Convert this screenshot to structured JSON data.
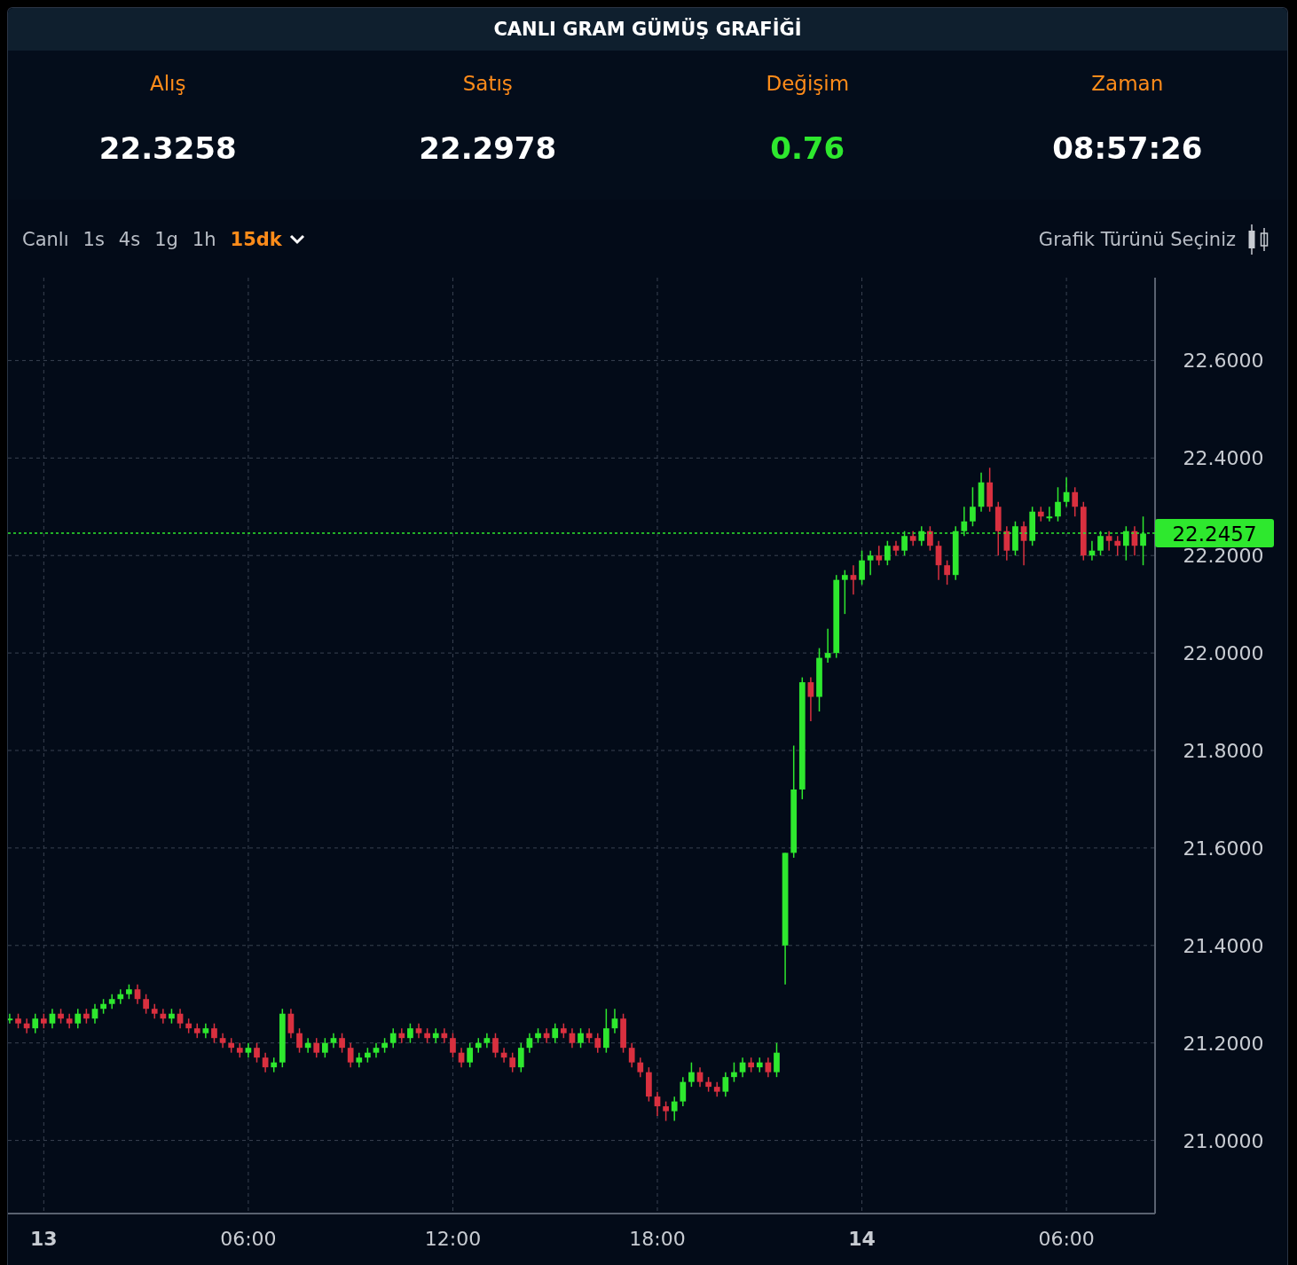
{
  "title": "CANLI GRAM GÜMÜŞ GRAFİĞİ",
  "stats": [
    {
      "label": "Alış",
      "value": "22.3258",
      "kind": "plain"
    },
    {
      "label": "Satış",
      "value": "22.2978",
      "kind": "plain"
    },
    {
      "label": "Değişim",
      "value": "0.76",
      "kind": "up"
    },
    {
      "label": "Zaman",
      "value": "08:57:26",
      "kind": "plain"
    }
  ],
  "timeframes": [
    {
      "label": "Canlı",
      "selected": false
    },
    {
      "label": "1s",
      "selected": false
    },
    {
      "label": "4s",
      "selected": false
    },
    {
      "label": "1g",
      "selected": false
    },
    {
      "label": "1h",
      "selected": false
    },
    {
      "label": "15dk",
      "selected": true
    }
  ],
  "chart_type_button": {
    "label": "Grafik Türünü Seçiniz"
  },
  "chart": {
    "chart_data": {
      "type": "candlestick",
      "grid": true,
      "ylim": [
        20.85,
        22.77
      ],
      "yticks": [
        {
          "value": 21.0,
          "label": "21.0000"
        },
        {
          "value": 21.2,
          "label": "21.2000"
        },
        {
          "value": 21.4,
          "label": "21.4000"
        },
        {
          "value": 21.6,
          "label": "21.6000"
        },
        {
          "value": 21.8,
          "label": "21.8000"
        },
        {
          "value": 22.0,
          "label": "22.0000"
        },
        {
          "value": 22.2,
          "label": "22.2000"
        },
        {
          "value": 22.4,
          "label": "22.4000"
        },
        {
          "value": 22.6,
          "label": "22.6000"
        }
      ],
      "xlim": [
        -1.05,
        32.6
      ],
      "xticks": [
        {
          "value": 6,
          "label": "06:00"
        },
        {
          "value": 12,
          "label": "12:00"
        },
        {
          "value": 18,
          "label": "18:00"
        }
      ],
      "x": [
        -1,
        -0.75,
        -0.5,
        -0.25,
        0,
        0.25,
        0.5,
        0.75,
        1,
        1.25,
        1.5,
        1.75,
        2,
        2.25,
        2.5,
        2.75,
        3,
        3.25,
        3.5,
        3.75,
        4,
        4.25,
        4.5,
        4.75,
        5,
        5.25,
        5.5,
        5.75,
        6,
        6.25,
        6.5,
        6.75,
        7,
        7.25,
        7.5,
        7.75,
        8,
        8.25,
        8.5,
        8.75,
        9,
        9.25,
        9.5,
        9.75,
        10,
        10.25,
        10.5,
        10.75,
        11,
        11.25,
        11.5,
        11.75,
        12,
        12.25,
        12.5,
        12.75,
        13,
        13.25,
        13.5,
        13.75,
        14,
        14.25,
        14.5,
        14.75,
        15,
        15.25,
        15.5,
        15.75,
        16,
        16.25,
        16.5,
        16.75,
        17,
        17.25,
        17.5,
        17.75,
        18,
        18.25,
        18.5,
        18.75,
        19,
        19.25,
        19.5,
        19.75,
        20,
        20.25,
        20.5,
        20.75,
        21,
        21.25,
        21.5,
        21.75,
        22,
        22.25,
        22.5,
        22.75,
        23,
        23.25,
        23.5,
        23.75,
        24,
        24.25,
        24.5,
        24.75,
        25,
        25.25,
        25.5,
        25.75,
        26,
        26.25,
        26.5,
        26.75,
        27,
        27.25,
        27.5,
        27.75,
        28,
        28.25,
        28.5,
        28.75,
        29,
        29.25,
        29.5,
        29.75,
        30,
        30.25,
        30.5,
        30.75,
        31,
        31.25,
        31.5,
        31.75,
        32,
        32.25
      ],
      "ohlc": [
        [
          21.25,
          21.26,
          21.24,
          21.25
        ],
        [
          21.25,
          21.26,
          21.23,
          21.24
        ],
        [
          21.24,
          21.25,
          21.22,
          21.23
        ],
        [
          21.23,
          21.26,
          21.22,
          21.25
        ],
        [
          21.25,
          21.26,
          21.23,
          21.24
        ],
        [
          21.24,
          21.27,
          21.23,
          21.26
        ],
        [
          21.26,
          21.27,
          21.24,
          21.25
        ],
        [
          21.25,
          21.26,
          21.23,
          21.24
        ],
        [
          21.24,
          21.27,
          21.23,
          21.26
        ],
        [
          21.26,
          21.27,
          21.24,
          21.25
        ],
        [
          21.25,
          21.28,
          21.24,
          21.27
        ],
        [
          21.27,
          21.29,
          21.26,
          21.28
        ],
        [
          21.28,
          21.3,
          21.27,
          21.29
        ],
        [
          21.29,
          21.31,
          21.28,
          21.3
        ],
        [
          21.3,
          21.32,
          21.29,
          21.31
        ],
        [
          21.31,
          21.32,
          21.28,
          21.29
        ],
        [
          21.29,
          21.3,
          21.26,
          21.27
        ],
        [
          21.27,
          21.28,
          21.25,
          21.26
        ],
        [
          21.26,
          21.27,
          21.24,
          21.25
        ],
        [
          21.25,
          21.27,
          21.24,
          21.26
        ],
        [
          21.26,
          21.27,
          21.23,
          21.24
        ],
        [
          21.24,
          21.25,
          21.22,
          21.23
        ],
        [
          21.23,
          21.24,
          21.21,
          21.22
        ],
        [
          21.22,
          21.24,
          21.21,
          21.23
        ],
        [
          21.23,
          21.24,
          21.2,
          21.21
        ],
        [
          21.21,
          21.22,
          21.19,
          21.2
        ],
        [
          21.2,
          21.21,
          21.18,
          21.19
        ],
        [
          21.19,
          21.2,
          21.17,
          21.18
        ],
        [
          21.18,
          21.2,
          21.17,
          21.19
        ],
        [
          21.19,
          21.2,
          21.16,
          21.17
        ],
        [
          21.17,
          21.18,
          21.14,
          21.15
        ],
        [
          21.15,
          21.17,
          21.14,
          21.16
        ],
        [
          21.16,
          21.27,
          21.15,
          21.26
        ],
        [
          21.26,
          21.27,
          21.21,
          21.22
        ],
        [
          21.22,
          21.23,
          21.18,
          21.19
        ],
        [
          21.19,
          21.21,
          21.18,
          21.2
        ],
        [
          21.2,
          21.21,
          21.17,
          21.18
        ],
        [
          21.18,
          21.21,
          21.17,
          21.2
        ],
        [
          21.2,
          21.22,
          21.19,
          21.21
        ],
        [
          21.21,
          21.22,
          21.18,
          21.19
        ],
        [
          21.19,
          21.2,
          21.15,
          21.16
        ],
        [
          21.16,
          21.18,
          21.15,
          21.17
        ],
        [
          21.17,
          21.19,
          21.16,
          21.18
        ],
        [
          21.18,
          21.2,
          21.17,
          21.19
        ],
        [
          21.19,
          21.21,
          21.18,
          21.2
        ],
        [
          21.2,
          21.23,
          21.19,
          21.22
        ],
        [
          21.22,
          21.23,
          21.2,
          21.21
        ],
        [
          21.21,
          21.24,
          21.2,
          21.23
        ],
        [
          21.23,
          21.24,
          21.21,
          21.22
        ],
        [
          21.22,
          21.23,
          21.2,
          21.21
        ],
        [
          21.21,
          21.23,
          21.2,
          21.22
        ],
        [
          21.22,
          21.23,
          21.2,
          21.21
        ],
        [
          21.21,
          21.22,
          21.17,
          21.18
        ],
        [
          21.18,
          21.19,
          21.15,
          21.16
        ],
        [
          21.16,
          21.2,
          21.15,
          21.19
        ],
        [
          21.19,
          21.21,
          21.18,
          21.2
        ],
        [
          21.2,
          21.22,
          21.19,
          21.21
        ],
        [
          21.21,
          21.22,
          21.17,
          21.18
        ],
        [
          21.18,
          21.19,
          21.16,
          21.17
        ],
        [
          21.17,
          21.18,
          21.14,
          21.15
        ],
        [
          21.15,
          21.2,
          21.14,
          21.19
        ],
        [
          21.19,
          21.22,
          21.18,
          21.21
        ],
        [
          21.21,
          21.23,
          21.2,
          21.22
        ],
        [
          21.22,
          21.23,
          21.2,
          21.21
        ],
        [
          21.21,
          21.24,
          21.2,
          21.23
        ],
        [
          21.23,
          21.24,
          21.21,
          21.22
        ],
        [
          21.22,
          21.23,
          21.19,
          21.2
        ],
        [
          21.2,
          21.23,
          21.19,
          21.22
        ],
        [
          21.22,
          21.23,
          21.2,
          21.21
        ],
        [
          21.21,
          21.22,
          21.18,
          21.19
        ],
        [
          21.19,
          21.27,
          21.18,
          21.23
        ],
        [
          21.23,
          21.27,
          21.22,
          21.25
        ],
        [
          21.25,
          21.26,
          21.18,
          21.19
        ],
        [
          21.19,
          21.2,
          21.15,
          21.16
        ],
        [
          21.16,
          21.17,
          21.13,
          21.14
        ],
        [
          21.14,
          21.15,
          21.08,
          21.09
        ],
        [
          21.09,
          21.1,
          21.05,
          21.07
        ],
        [
          21.07,
          21.08,
          21.04,
          21.06
        ],
        [
          21.06,
          21.09,
          21.04,
          21.08
        ],
        [
          21.08,
          21.13,
          21.07,
          21.12
        ],
        [
          21.12,
          21.16,
          21.11,
          21.14
        ],
        [
          21.14,
          21.15,
          21.11,
          21.12
        ],
        [
          21.12,
          21.13,
          21.1,
          21.11
        ],
        [
          21.11,
          21.12,
          21.09,
          21.1
        ],
        [
          21.1,
          21.14,
          21.09,
          21.13
        ],
        [
          21.13,
          21.16,
          21.12,
          21.14
        ],
        [
          21.14,
          21.17,
          21.13,
          21.16
        ],
        [
          21.16,
          21.17,
          21.14,
          21.15
        ],
        [
          21.15,
          21.17,
          21.14,
          21.16
        ],
        [
          21.16,
          21.17,
          21.13,
          21.14
        ],
        [
          21.14,
          21.2,
          21.13,
          21.18
        ],
        [
          21.4,
          21.59,
          21.32,
          21.59
        ],
        [
          21.59,
          21.81,
          21.58,
          21.72
        ],
        [
          21.72,
          21.95,
          21.7,
          21.94
        ],
        [
          21.94,
          21.95,
          21.86,
          21.91
        ],
        [
          21.91,
          22.01,
          21.88,
          21.99
        ],
        [
          21.99,
          22.05,
          21.98,
          22.0
        ],
        [
          22.0,
          22.16,
          21.99,
          22.15
        ],
        [
          22.15,
          22.17,
          22.08,
          22.16
        ],
        [
          22.16,
          22.18,
          22.12,
          22.15
        ],
        [
          22.15,
          22.21,
          22.14,
          22.19
        ],
        [
          22.19,
          22.21,
          22.16,
          22.2
        ],
        [
          22.2,
          22.22,
          22.18,
          22.19
        ],
        [
          22.19,
          22.23,
          22.18,
          22.22
        ],
        [
          22.22,
          22.23,
          22.2,
          22.21
        ],
        [
          22.21,
          22.25,
          22.2,
          22.24
        ],
        [
          22.24,
          22.25,
          22.22,
          22.23
        ],
        [
          22.23,
          22.26,
          22.22,
          22.25
        ],
        [
          22.25,
          22.26,
          22.21,
          22.22
        ],
        [
          22.22,
          22.23,
          22.15,
          22.18
        ],
        [
          22.18,
          22.19,
          22.14,
          22.16
        ],
        [
          22.16,
          22.26,
          22.15,
          22.25
        ],
        [
          22.25,
          22.3,
          22.24,
          22.27
        ],
        [
          22.27,
          22.34,
          22.26,
          22.3
        ],
        [
          22.3,
          22.37,
          22.29,
          22.35
        ],
        [
          22.35,
          22.38,
          22.29,
          22.3
        ],
        [
          22.3,
          22.31,
          22.2,
          22.25
        ],
        [
          22.25,
          22.26,
          22.19,
          22.21
        ],
        [
          22.21,
          22.27,
          22.2,
          22.26
        ],
        [
          22.26,
          22.27,
          22.18,
          22.23
        ],
        [
          22.23,
          22.3,
          22.22,
          22.29
        ],
        [
          22.29,
          22.3,
          22.27,
          22.28
        ],
        [
          22.28,
          22.3,
          22.27,
          22.28
        ],
        [
          22.28,
          22.34,
          22.27,
          22.31
        ],
        [
          22.31,
          22.36,
          22.3,
          22.33
        ],
        [
          22.33,
          22.34,
          22.28,
          22.3
        ],
        [
          22.3,
          22.31,
          22.19,
          22.2
        ],
        [
          22.2,
          22.23,
          22.19,
          22.21
        ],
        [
          22.21,
          22.25,
          22.2,
          22.24
        ],
        [
          22.24,
          22.25,
          22.21,
          22.23
        ],
        [
          22.23,
          22.24,
          22.2,
          22.22
        ],
        [
          22.22,
          22.26,
          22.19,
          22.25
        ],
        [
          22.25,
          22.26,
          22.2,
          22.22
        ],
        [
          22.22,
          22.28,
          22.18,
          22.245
        ]
      ],
      "ref_lines": [
        {
          "axis": "y",
          "value": 22.2457,
          "label": "22.2457"
        }
      ]
    },
    "extra_axis_labels": [
      {
        "label": "13",
        "kind": "day"
      },
      {
        "label": "14",
        "kind": "day"
      },
      {
        "label": "06:00",
        "kind": "time"
      }
    ]
  }
}
